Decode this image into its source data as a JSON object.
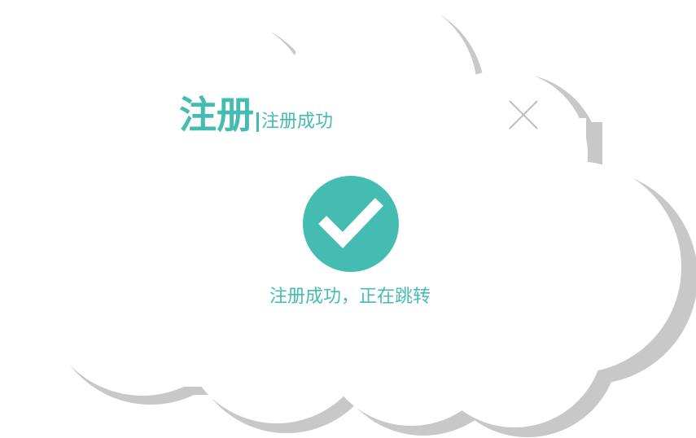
{
  "dialog": {
    "title": "注册",
    "subtitle": "注册成功",
    "close_icon": "close-icon"
  },
  "status": {
    "icon": "checkmark-circle-icon",
    "message": "注册成功，正在跳转"
  },
  "colors": {
    "accent": "#45bcb1",
    "cloud_fill": "#ffffff",
    "cloud_shadow": "#c8c8c8",
    "close_icon": "#bdbdbd"
  }
}
